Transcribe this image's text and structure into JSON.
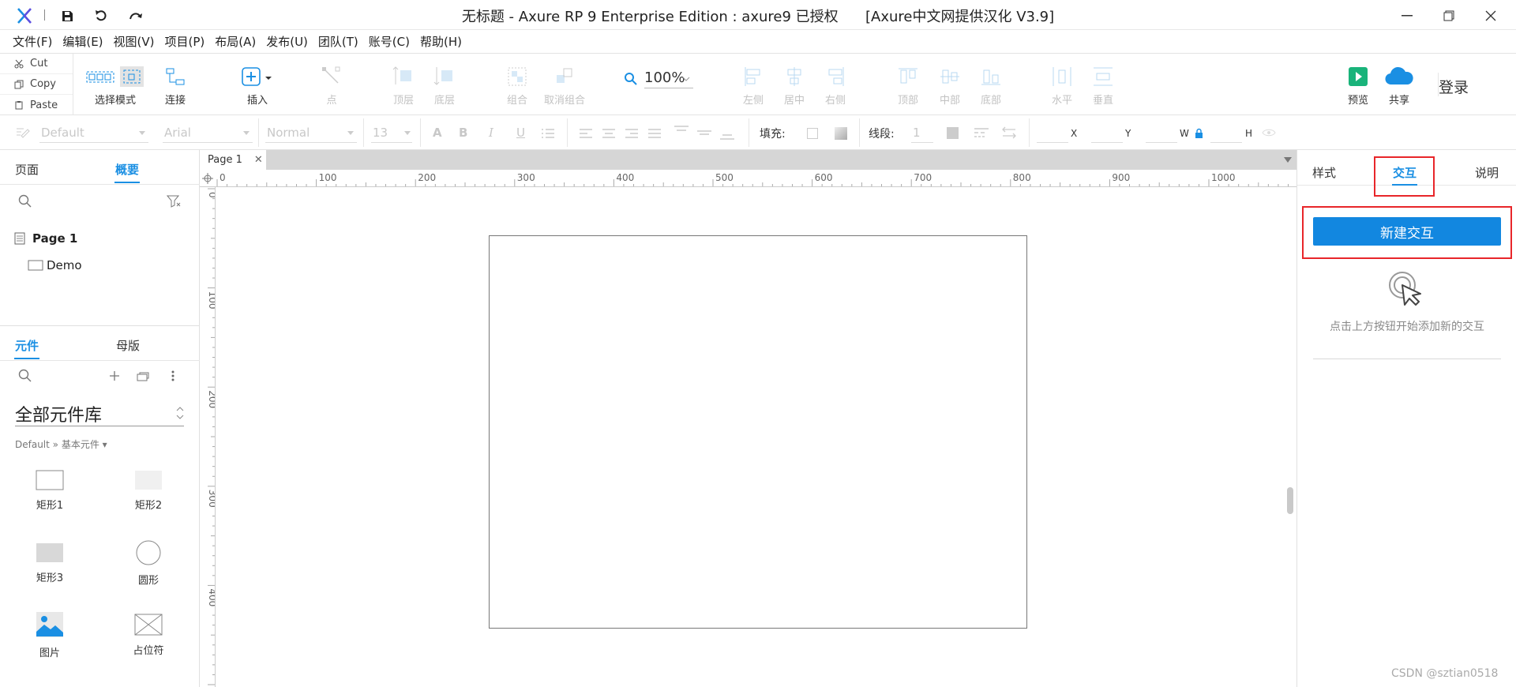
{
  "titlebar": {
    "title": "无标题 - Axure RP 9 Enterprise Edition : axure9 已授权",
    "subtitle": "[Axure中文网提供汉化 V3.9]"
  },
  "menu": [
    "文件(F)",
    "编辑(E)",
    "视图(V)",
    "项目(P)",
    "布局(A)",
    "发布(U)",
    "团队(T)",
    "账号(C)",
    "帮助(H)"
  ],
  "clipboard": {
    "cut": "Cut",
    "copy": "Copy",
    "paste": "Paste"
  },
  "toolbar": {
    "select_mode": "选择模式",
    "connect": "连接",
    "insert": "插入",
    "point": "点",
    "top_layer": "顶层",
    "bottom_layer": "底层",
    "group": "组合",
    "ungroup": "取消组合",
    "zoom": "100%",
    "left": "左侧",
    "center": "居中",
    "right": "右侧",
    "top": "顶部",
    "middle": "中部",
    "bottom": "底部",
    "horizontal": "水平",
    "vertical": "垂直",
    "preview": "预览",
    "share": "共享",
    "login": "登录"
  },
  "stylebar": {
    "style": "Default",
    "font": "Arial",
    "weight": "Normal",
    "size": "13",
    "fill_label": "填充:",
    "line_label": "线段:",
    "line_value": "1",
    "x_label": "X",
    "y_label": "Y",
    "w_label": "W",
    "h_label": "H"
  },
  "pages_panel": {
    "tabs": [
      "页面",
      "概要"
    ],
    "active_tab": "概要",
    "page_name": "Page 1",
    "child": "Demo"
  },
  "library_panel": {
    "tabs": [
      "元件",
      "母版"
    ],
    "active_tab": "元件",
    "library_name": "全部元件库",
    "breadcrumb": "Default » 基本元件 ▾",
    "widgets": [
      "矩形1",
      "矩形2",
      "矩形3",
      "圆形",
      "图片",
      "占位符"
    ]
  },
  "canvas": {
    "tab_label": "Page 1",
    "ruler_h": [
      "0",
      "100",
      "200",
      "300",
      "400",
      "500",
      "600",
      "700",
      "800",
      "900",
      "1000"
    ],
    "ruler_v": [
      "0",
      "100",
      "200",
      "300",
      "400"
    ]
  },
  "right_panel": {
    "tabs": [
      "样式",
      "交互",
      "说明"
    ],
    "active_tab": "交互",
    "new_interaction": "新建交互",
    "hint": "点击上方按钮开始添加新的交互"
  },
  "watermark": "CSDN @sztian0518",
  "colors": {
    "accent": "#1a8fe3",
    "button": "#1287e0",
    "highlight": "#e8262a",
    "preview": "#19b37a"
  }
}
